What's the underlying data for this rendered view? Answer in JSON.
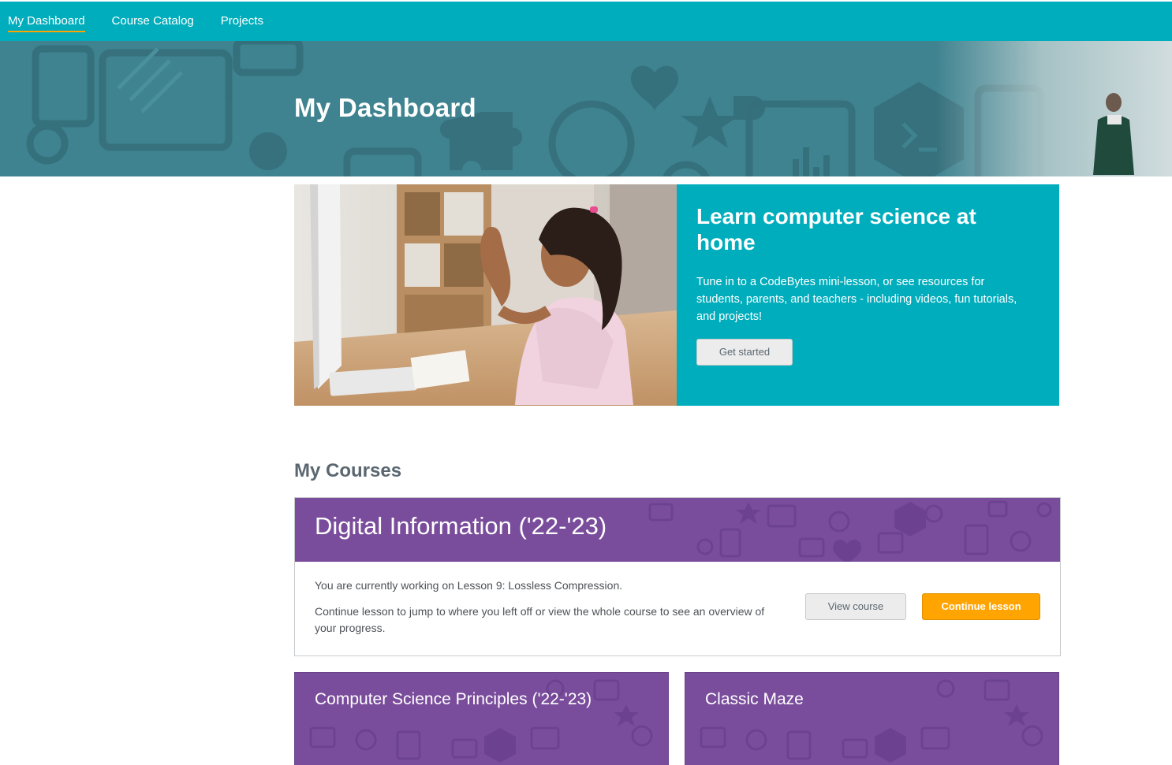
{
  "nav": {
    "items": [
      {
        "label": "My Dashboard",
        "active": true
      },
      {
        "label": "Course Catalog",
        "active": false
      },
      {
        "label": "Projects",
        "active": false
      }
    ]
  },
  "hero": {
    "title": "My Dashboard"
  },
  "promo": {
    "heading": "Learn computer science at home",
    "body": "Tune in to a CodeBytes mini-lesson, or see resources for students, parents, and teachers - including videos, fun tutorials, and projects!",
    "button_label": "Get started"
  },
  "courses": {
    "section_title": "My Courses",
    "current": {
      "title": "Digital Information ('22-'23)",
      "status": "You are currently working on Lesson 9: Lossless Compression.",
      "description": "Continue lesson to jump to where you left off or view the whole course to see an overview of your progress.",
      "view_label": "View course",
      "continue_label": "Continue lesson"
    },
    "others": [
      {
        "title": "Computer Science Principles ('22-'23)"
      },
      {
        "title": "Classic Maze"
      }
    ]
  },
  "colors": {
    "teal": "#00adbc",
    "hero_bg": "#3f8390",
    "purple": "#7a4d9c",
    "orange": "#ffa400"
  }
}
